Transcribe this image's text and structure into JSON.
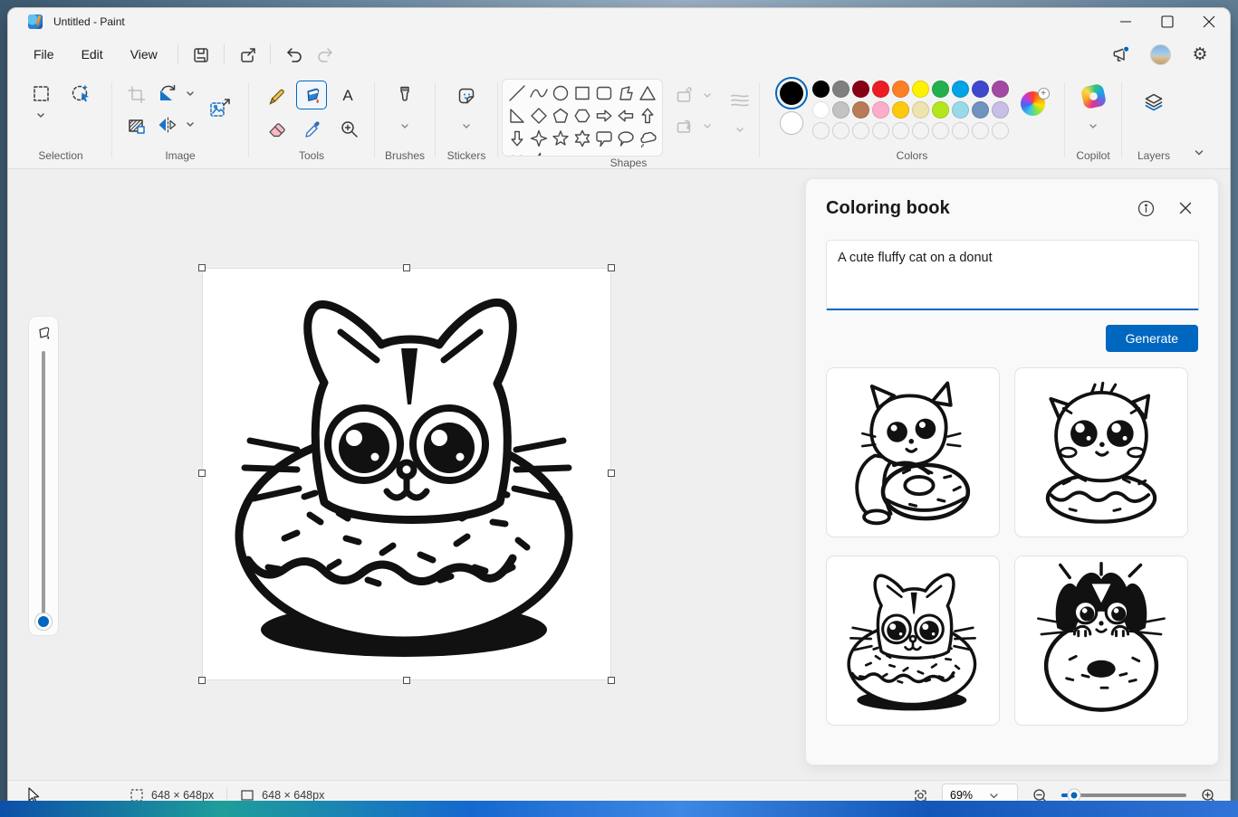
{
  "titlebar": {
    "title": "Untitled - Paint"
  },
  "menubar": {
    "file": "File",
    "edit": "Edit",
    "view": "View"
  },
  "ribbon": {
    "labels": {
      "selection": "Selection",
      "image": "Image",
      "tools": "Tools",
      "brushes": "Brushes",
      "stickers": "Stickers",
      "shapes": "Shapes",
      "colors": "Colors",
      "copilot": "Copilot",
      "layers": "Layers"
    },
    "shapes": [
      "line",
      "curve",
      "ellipse",
      "rectangle",
      "rounded-rectangle",
      "polygon",
      "triangle",
      "right-triangle",
      "diamond",
      "pentagon",
      "hexagon",
      "arrow-right",
      "arrow-left",
      "arrow-up",
      "arrow-down",
      "star-four",
      "star-five",
      "star-six",
      "callout-rounded",
      "callout-oval",
      "callout-cloud",
      "heart",
      "lightning"
    ],
    "palette": {
      "foreground": "#000000",
      "background": "#ffffff",
      "row1": [
        "#000000",
        "#7f7f7f",
        "#880015",
        "#ed1c24",
        "#ff7f27",
        "#fff200",
        "#22b14c",
        "#00a2e8",
        "#3f48cc",
        "#a349a4"
      ],
      "row2": [
        "#ffffff",
        "#c3c3c3",
        "#b97a57",
        "#ffaec9",
        "#ffc90e",
        "#efe4b0",
        "#b5e61d",
        "#99d9ea",
        "#7092be",
        "#c8bfe7"
      ],
      "empty_slots": 10
    }
  },
  "panel": {
    "title": "Coloring book",
    "prompt_value": "A cute fluffy cat on a donut",
    "generate_label": "Generate",
    "accent": "#0067c0",
    "thumbnails": [
      "cat-hugging-donut",
      "fluffy-cat-sitting-on-donut",
      "cat-head-in-donut",
      "black-and-white-cat-on-donut"
    ]
  },
  "canvas": {
    "art": "cat-head-in-donut-line-art"
  },
  "statusbar": {
    "selection_size": "648 × 648px",
    "canvas_size": "648 × 648px",
    "zoom": "69%"
  },
  "colors": {
    "accent": "#0067c0",
    "window_bg": "#f3f3f3",
    "workspace_bg": "#eeefee"
  }
}
